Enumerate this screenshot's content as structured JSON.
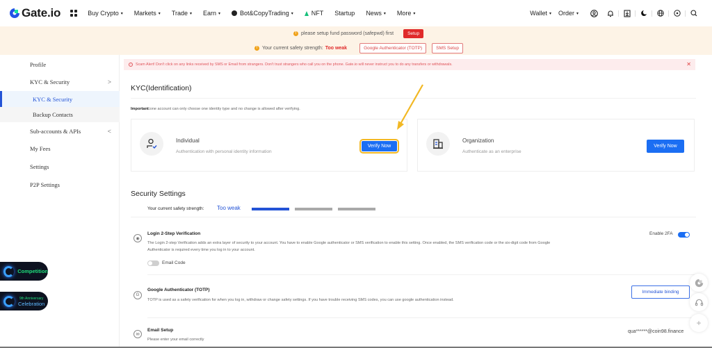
{
  "brand": {
    "name": "Gate.io",
    "accent": "#1b6ef3",
    "logo_color": "#2354e6",
    "logo_accent": "#17e5a0"
  },
  "nav": {
    "items": [
      {
        "label": "Buy Crypto",
        "dropdown": true
      },
      {
        "label": "Markets",
        "dropdown": true
      },
      {
        "label": "Trade",
        "dropdown": true
      },
      {
        "label": "Earn",
        "dropdown": true
      },
      {
        "label": "Bot&CopyTrading",
        "dropdown": true,
        "icon": "bot-icon"
      },
      {
        "label": "NFT",
        "dropdown": false,
        "icon": "nft-icon"
      },
      {
        "label": "Startup",
        "dropdown": false
      },
      {
        "label": "News",
        "dropdown": true
      },
      {
        "label": "More",
        "dropdown": true
      }
    ],
    "caret": "▾",
    "right": {
      "wallet": "Wallet",
      "order": "Order",
      "icons": [
        "user-icon",
        "bell-icon",
        "download-icon",
        "theme-icon",
        "globe-icon",
        "settings-icon",
        "search-icon"
      ]
    }
  },
  "notice": {
    "fund_password": "please setup fund password (safepwd) first",
    "setup_label": "Setup",
    "strength_prefix": "Your current safety strength:",
    "strength_value": "Too weak",
    "google_auth_label": "Google Authenticator (TOTP)",
    "sms_setup_label": "SMS Setup"
  },
  "sidebar": {
    "items": [
      {
        "label": "Profile"
      },
      {
        "label": "KYC & Security",
        "chevron": ">"
      },
      {
        "label": "KYC & Security",
        "active": true
      },
      {
        "label": "Backup Contacts",
        "sub": true
      },
      {
        "label": "Sub-accounts & APIs",
        "chevron": "<"
      },
      {
        "label": "My Fees"
      },
      {
        "label": "Settings"
      },
      {
        "label": "P2P Settings"
      }
    ],
    "promos": [
      {
        "label": "Competition"
      },
      {
        "small": "9th Anniversary",
        "big": "Celebration"
      }
    ]
  },
  "main": {
    "scam_alert": "Scam Alert! Don't click on any links received by SMS or Email from strangers. Don't trust strangers who call you on the phone. Gate.io will never instruct you to do any transfers or withdrawals.",
    "close": "✕",
    "kyc": {
      "title": "KYC(Identification)",
      "important_label": "Important:",
      "important_text": "one account can only choose one identity type and no change is allowed after verifying.",
      "individual": {
        "title": "Individual",
        "desc": "Authentication with personal identity information",
        "button": "Verify Now"
      },
      "organization": {
        "title": "Organization",
        "desc": "Authenticate as an enterprise",
        "button": "Verify Now"
      }
    },
    "security": {
      "title": "Security Settings",
      "strength_label": "Your current safety strength:",
      "strength_value": "Too weak",
      "strength_level": "1 of 3",
      "login_2fa": {
        "title": "Login 2-Step Verification",
        "desc": "The Login 2-step Verification adds an extra layer of security to your account. You have to enable Google authenticator or SMS verification to enable this setting. Once enabled, the SMS verification code or the six-digit code from Google Authenticator is required every time you log in to your account.",
        "enable_label": "Enable 2FA",
        "enable_on": true,
        "email_code_label": "Email Code",
        "email_code_on": false
      },
      "google_auth": {
        "title": "Google Authenticator (TOTP)",
        "desc": "TOTP is used as a safety verification for when you log in, withdraw or change safety settings. If you have trouble receiving SMS codes, you can use google authentication instead.",
        "button": "Immediate binding"
      },
      "email": {
        "title": "Email Setup",
        "desc": "Please enter your email correctly",
        "value": "qua******@coin98.finance"
      }
    }
  },
  "floating": {
    "icons": [
      "gate-icon",
      "headset-icon",
      "plus-icon"
    ],
    "plus": "+"
  }
}
